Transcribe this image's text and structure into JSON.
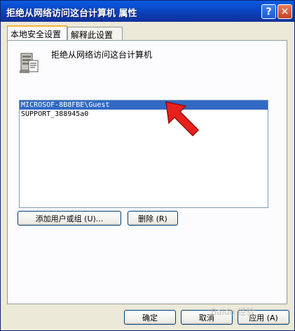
{
  "window": {
    "title": "拒绝从网络访问这台计算机 属性",
    "help_label": "?",
    "close_label": "✕"
  },
  "tabs": [
    {
      "label": "本地安全设置",
      "active": true
    },
    {
      "label": "解释此设置",
      "active": false
    }
  ],
  "policy": {
    "icon": "server-policy-icon",
    "title": "拒绝从网络访问这台计算机"
  },
  "accounts": [
    {
      "label": "MICROSOF-8B8FBE\\Guest",
      "selected": true
    },
    {
      "label": "SUPPORT_388945a0",
      "selected": false
    }
  ],
  "buttons": {
    "add": "添加用户或组 (U)...",
    "remove": "删除 (R)",
    "ok": "确定",
    "cancel": "取消",
    "apply": "应用 (A)"
  },
  "annotation": {
    "icon": "red-arrow-icon",
    "color": "#E8201C"
  },
  "watermark": "Baidu 经验",
  "colors": {
    "titlebar": "#0A3FB8",
    "selection": "#316AC5",
    "tab_highlight": "#F9B33A"
  }
}
